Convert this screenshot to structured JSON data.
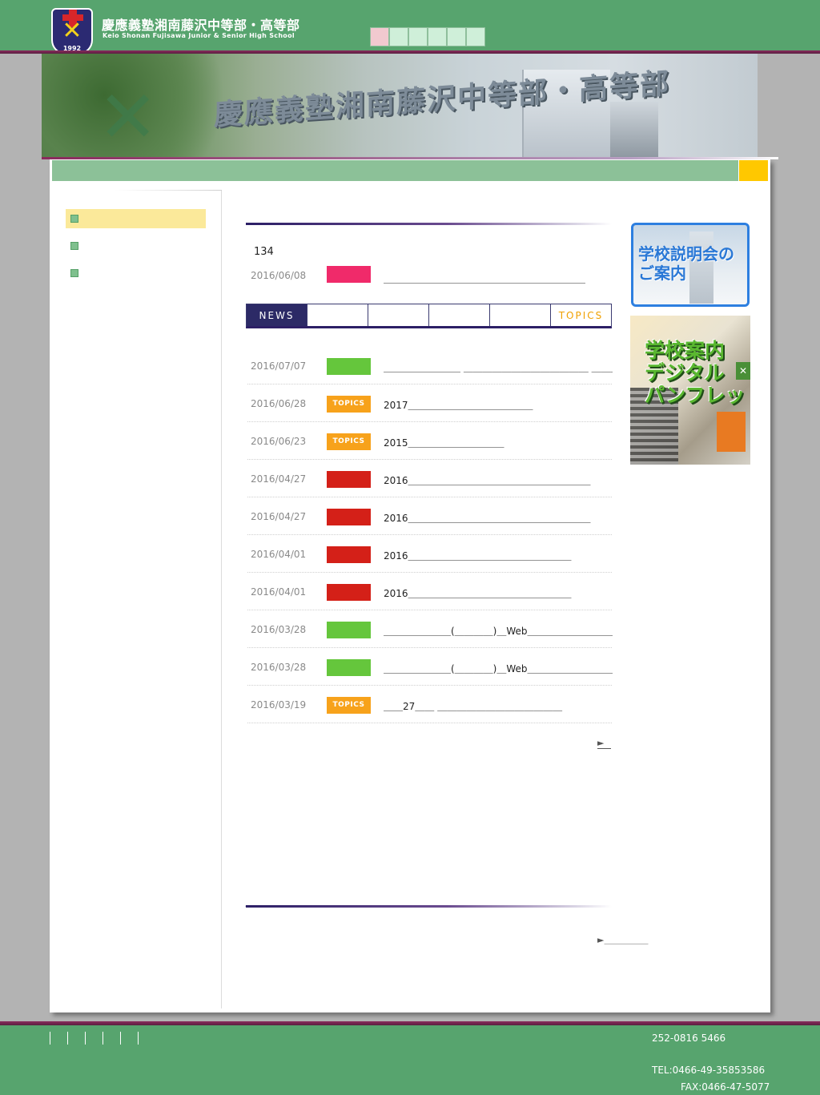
{
  "header": {
    "title": "慶應義塾湘南藤沢中等部・高等部",
    "subtitle": "Keio Shonan Fujisawa Junior & Senior High School",
    "logo_year": "1992",
    "swatches": [
      "#f1c9cf",
      "#cfefd9",
      "#cfefd9",
      "#cfefd9",
      "#cfefd9",
      "#cfefd9"
    ]
  },
  "banner": {
    "title": "慶應義塾湘南藤沢中等部・高等部"
  },
  "sidebar": {
    "items": [
      {
        "label": "",
        "active": true
      },
      {
        "label": "",
        "active": false
      },
      {
        "label": "",
        "active": false
      }
    ]
  },
  "content": {
    "count": "134",
    "pinned": {
      "date": "2016/06/08",
      "tag_color": "pink",
      "title": "＿＿＿＿＿＿＿＿＿＿＿＿＿＿＿＿＿＿＿＿＿"
    },
    "tabs": [
      {
        "label": "NEWS",
        "active": true
      },
      {
        "label": "",
        "active": false
      },
      {
        "label": "",
        "active": false
      },
      {
        "label": "",
        "active": false
      },
      {
        "label": "",
        "active": false
      },
      {
        "label": "TOPICS",
        "active": false
      }
    ],
    "news": [
      {
        "date": "2016/07/07",
        "tag": "",
        "tag_color": "green",
        "title": "＿＿＿＿＿＿＿＿ ＿＿＿＿＿＿＿＿＿＿＿＿＿ ＿＿＿＿＿＿＿ ＿＿＿"
      },
      {
        "date": "2016/06/28",
        "tag": "TOPICS",
        "tag_color": "orange",
        "title": "2017＿＿＿＿＿＿＿＿＿＿＿＿＿"
      },
      {
        "date": "2016/06/23",
        "tag": "TOPICS",
        "tag_color": "orange",
        "title": "2015＿＿＿＿＿＿＿＿＿＿"
      },
      {
        "date": "2016/04/27",
        "tag": "",
        "tag_color": "red",
        "title": "2016＿＿＿＿＿＿＿＿＿＿＿＿＿＿＿＿＿＿＿"
      },
      {
        "date": "2016/04/27",
        "tag": "",
        "tag_color": "red",
        "title": "2016＿＿＿＿＿＿＿＿＿＿＿＿＿＿＿＿＿＿＿"
      },
      {
        "date": "2016/04/01",
        "tag": "",
        "tag_color": "red",
        "title": "2016＿＿＿＿＿＿＿＿＿＿＿＿＿＿＿＿＿"
      },
      {
        "date": "2016/04/01",
        "tag": "",
        "tag_color": "red",
        "title": "2016＿＿＿＿＿＿＿＿＿＿＿＿＿＿＿＿＿"
      },
      {
        "date": "2016/03/28",
        "tag": "",
        "tag_color": "green",
        "title": "＿＿＿＿＿＿＿(＿＿＿＿)＿Web＿＿＿＿＿＿＿＿＿＿＿＿＿＿"
      },
      {
        "date": "2016/03/28",
        "tag": "",
        "tag_color": "green",
        "title": "＿＿＿＿＿＿＿(＿＿＿＿)＿Web＿＿＿＿＿＿＿＿＿＿＿"
      },
      {
        "date": "2016/03/19",
        "tag": "TOPICS",
        "tag_color": "orange",
        "title": "＿＿27＿＿ ＿＿＿＿＿＿＿＿＿＿＿＿＿"
      }
    ],
    "more_arrow": "►",
    "sub_heading": "＿＿＿＿＿＿＿＿＿＿＿＿＿＿",
    "sub_more": "►＿＿＿＿＿"
  },
  "promos": {
    "p1": "学校説明会の\nご案内",
    "p2": "学校案内\nデジタル\nパンフレット",
    "p2_close": "✕"
  },
  "footer": {
    "postal": "252-0816 5466",
    "tel": "TEL:0466-49-35853586",
    "fax": "FAX:0466-47-5077"
  }
}
